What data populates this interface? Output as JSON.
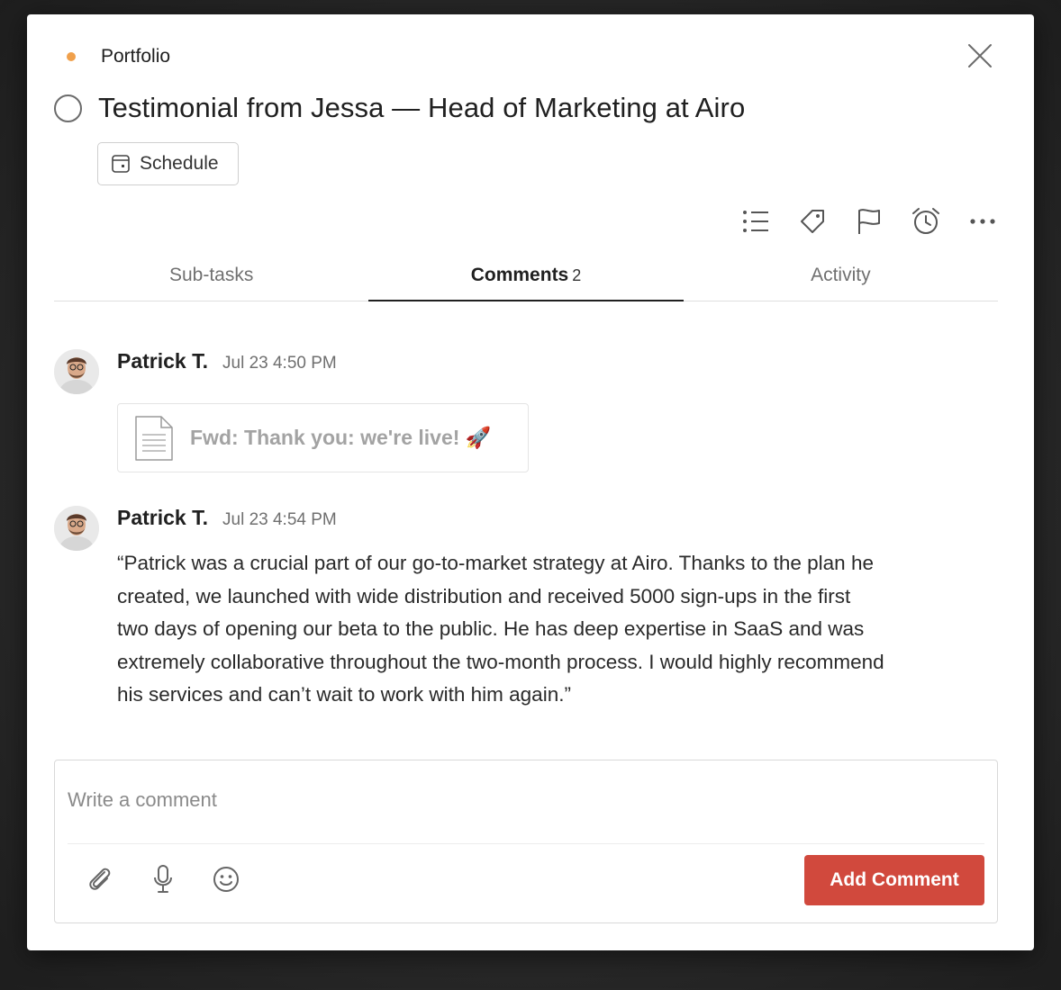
{
  "project": {
    "name": "Portfolio",
    "dot_color": "#f0a04b"
  },
  "task": {
    "title": "Testimonial from Jessa — Head of Marketing at Airo",
    "schedule_label": "Schedule"
  },
  "toolbar": {
    "icons": [
      "subtasks-list-icon",
      "label-tag-icon",
      "priority-flag-icon",
      "reminder-alarm-icon",
      "more-options-icon"
    ]
  },
  "tabs": [
    {
      "label": "Sub-tasks",
      "count": ""
    },
    {
      "label": "Comments",
      "count": "2"
    },
    {
      "label": "Activity",
      "count": ""
    }
  ],
  "active_tab": "Comments",
  "comments": [
    {
      "author": "Patrick T.",
      "time": "Jul 23 4:50 PM",
      "attachment": "Fwd: Thank you: we're live! 🚀"
    },
    {
      "author": "Patrick T.",
      "time": "Jul 23 4:54 PM",
      "lines": [
        "“Patrick was a crucial part of our go-to-market strategy at Airo. Thanks to the plan he",
        "created, we launched with wide distribution and received 5000 sign-ups in the first",
        "two days of opening our beta to the public. He has deep expertise in SaaS and was",
        "extremely collaborative throughout the two-month process. I would highly recommend",
        "his services and can’t wait to work with him again.”"
      ]
    }
  ],
  "editor": {
    "placeholder": "Write a comment",
    "value": "",
    "submit_label": "Add Comment",
    "submit_color": "#d1493d"
  }
}
